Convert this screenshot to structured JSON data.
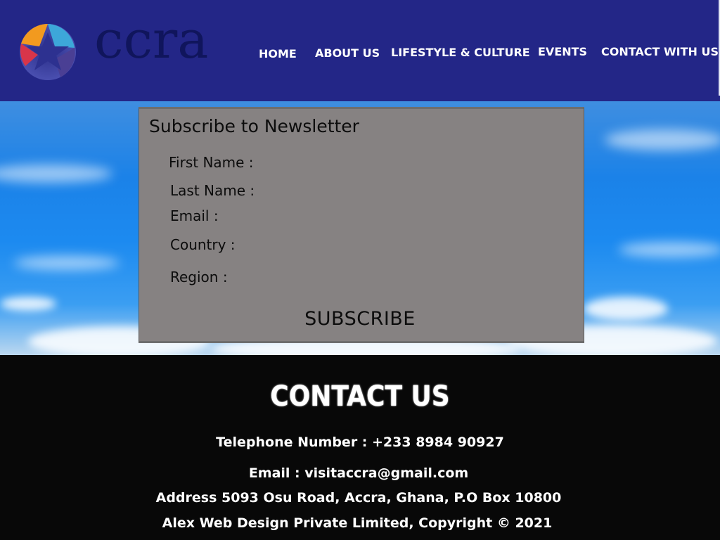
{
  "header": {
    "logo": {
      "wordmark": "ccra",
      "tagline": "",
      "colors": [
        "#f59e1c",
        "#d4334a",
        "#3aa6d8",
        "#5a3d8f"
      ]
    },
    "nav": [
      {
        "label": "HOME"
      },
      {
        "label": "ABOUT US"
      },
      {
        "label": "LIFESTYLE & CULTURE"
      },
      {
        "label": "EVENTS"
      },
      {
        "label": "CONTACT WITH US"
      }
    ]
  },
  "newsletter": {
    "title": "Subscribe to Newsletter",
    "fields": [
      {
        "label": "First Name :",
        "value": ""
      },
      {
        "label": "Last Name :",
        "value": ""
      },
      {
        "label": "Email :",
        "value": ""
      },
      {
        "label": "Country :",
        "value": ""
      },
      {
        "label": "Region :",
        "value": ""
      }
    ],
    "submit_label": "SUBSCRIBE"
  },
  "footer": {
    "title": "CONTACT US",
    "telephone": "Telephone Number : +233 8984 90927",
    "email": "Email : visitaccra@gmail.com",
    "address": "Address 5093 Osu Road, Accra, Ghana, P.O Box 10800",
    "copyright": "Alex Web Design Private Limited, Copyright © 2021"
  },
  "colors": {
    "header_bg": "#232687",
    "form_bg": "#868282",
    "footer_bg": "#080808",
    "sky": "#1c86ee"
  }
}
